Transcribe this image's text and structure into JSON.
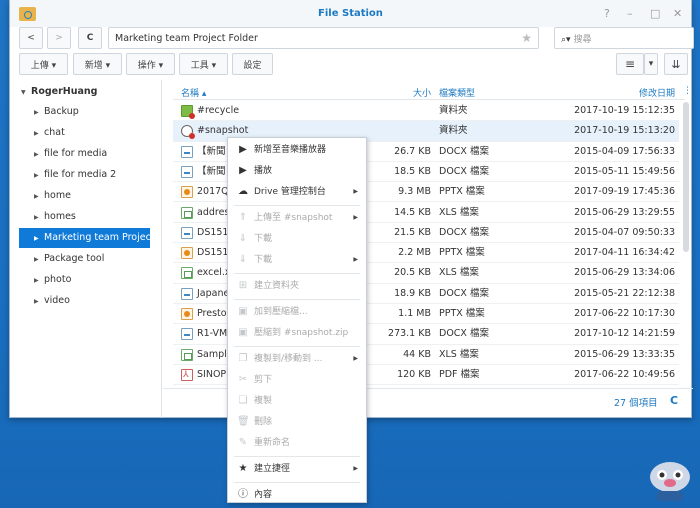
{
  "window": {
    "title": "File Station",
    "help": "?",
    "minimize": "–",
    "maximize": "□",
    "close": "✕"
  },
  "nav": {
    "back": "<",
    "forward": ">",
    "refresh": "C",
    "path": "Marketing team Project Folder",
    "favorite": "★",
    "search_icon": "⌕▾",
    "search_placeholder": "搜尋"
  },
  "toolbar": {
    "upload": "上傳 ▾",
    "create": "新增 ▾",
    "action": "操作 ▾",
    "tools": "工具 ▾",
    "settings": "設定",
    "view_list": "≡",
    "view_dropdown": "▾",
    "sort": "⇊"
  },
  "sidebar": {
    "root": "RogerHuang",
    "items": [
      "Backup",
      "chat",
      "file for media",
      "file for media 2",
      "home",
      "homes",
      "Marketing team Project Folder",
      "Package tool",
      "photo",
      "video"
    ]
  },
  "columns": {
    "name": "名稱 ▴",
    "size": "大小",
    "type": "檔案類型",
    "modified": "修改日期",
    "more": "⋮"
  },
  "files": [
    {
      "icon": "recycle",
      "name": "#recycle",
      "size": "",
      "type": "資料夾",
      "modified": "2017-10-19 15:12:35"
    },
    {
      "icon": "snap",
      "name": "#snapshot",
      "size": "",
      "type": "資料夾",
      "modified": "2017-10-19 15:13:20"
    },
    {
      "icon": "docx",
      "name": "【新聞",
      "size": "26.7 KB",
      "type": "DOCX 檔案",
      "modified": "2015-04-09 17:56:33"
    },
    {
      "icon": "docx",
      "name": "【新聞",
      "size": "18.5 KB",
      "type": "DOCX 檔案",
      "modified": "2015-05-11 15:49:56"
    },
    {
      "icon": "pptx",
      "name": "2017Q",
      "size": "9.3 MB",
      "type": "PPTX 檔案",
      "modified": "2017-09-19 17:45:36"
    },
    {
      "icon": "xls",
      "name": "addres",
      "size": "14.5 KB",
      "type": "XLS 檔案",
      "modified": "2015-06-29 13:29:55"
    },
    {
      "icon": "docx",
      "name": "DS151",
      "size": "21.5 KB",
      "type": "DOCX 檔案",
      "modified": "2015-04-07 09:50:33"
    },
    {
      "icon": "pptx",
      "name": "DS151",
      "size": "2.2 MB",
      "type": "PPTX 檔案",
      "modified": "2017-04-11 16:34:42"
    },
    {
      "icon": "xls",
      "name": "excel.x",
      "size": "20.5 KB",
      "type": "XLS 檔案",
      "modified": "2015-06-29 13:34:06"
    },
    {
      "icon": "docx",
      "name": "Japane",
      "size": "18.9 KB",
      "type": "DOCX 檔案",
      "modified": "2015-05-21 22:12:38"
    },
    {
      "icon": "pptx",
      "name": "Presto",
      "size": "1.1 MB",
      "type": "PPTX 檔案",
      "modified": "2017-06-22 10:17:30"
    },
    {
      "icon": "docx",
      "name": "R1-VM",
      "size": "273.1 KB",
      "type": "DOCX 檔案",
      "modified": "2017-10-12 14:21:59"
    },
    {
      "icon": "xls",
      "name": "Sample",
      "size": "44 KB",
      "type": "XLS 檔案",
      "modified": "2015-06-29 13:33:35"
    },
    {
      "icon": "pdf",
      "name": "SINOP",
      "size": "120 KB",
      "type": "PDF 檔案",
      "modified": "2017-06-22 10:49:56"
    }
  ],
  "footer": {
    "count": "27 個項目",
    "refresh": "C"
  },
  "context_menu": [
    {
      "icon": "▶",
      "label": "新增至音樂播放器",
      "disabled": false,
      "sub": false
    },
    {
      "icon": "▶",
      "label": "播放",
      "disabled": false,
      "sub": false
    },
    {
      "icon": "☁",
      "label": "Drive 管理控制台",
      "disabled": false,
      "sub": true
    },
    {
      "icon": "⇑",
      "label": "上傳至 #snapshot",
      "disabled": true,
      "sub": true,
      "sep": true
    },
    {
      "icon": "⇓",
      "label": "下載",
      "disabled": true,
      "sub": false
    },
    {
      "icon": "⇓",
      "label": "下載",
      "disabled": true,
      "sub": true
    },
    {
      "icon": "⊞",
      "label": "建立資料夾",
      "disabled": true,
      "sub": false,
      "sep": true
    },
    {
      "icon": "▣",
      "label": "加到壓縮檔...",
      "disabled": true,
      "sub": false,
      "sep": true
    },
    {
      "icon": "▣",
      "label": "壓縮到 #snapshot.zip",
      "disabled": true,
      "sub": false
    },
    {
      "icon": "❐",
      "label": "複製到/移動到 ...",
      "disabled": true,
      "sub": true,
      "sep": true
    },
    {
      "icon": "✂",
      "label": "剪下",
      "disabled": true,
      "sub": false
    },
    {
      "icon": "❏",
      "label": "複製",
      "disabled": true,
      "sub": false
    },
    {
      "icon": "🗑",
      "label": "刪除",
      "disabled": true,
      "sub": false
    },
    {
      "icon": "✎",
      "label": "重新命名",
      "disabled": true,
      "sub": false
    },
    {
      "icon": "★",
      "label": "建立捷徑",
      "disabled": false,
      "sub": true,
      "sep": true
    },
    {
      "icon": "ⓘ",
      "label": "內容",
      "disabled": false,
      "sub": false,
      "sep": true
    }
  ],
  "colors": {
    "accent": "#1d7ac2",
    "selection": "#0f7ad8",
    "desktop": "#1f74c4"
  }
}
